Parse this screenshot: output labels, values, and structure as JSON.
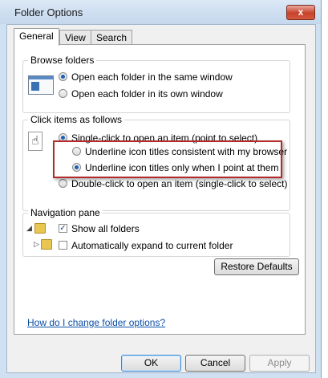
{
  "window": {
    "title": "Folder Options",
    "close_label": "x"
  },
  "tabs": [
    {
      "label": "General",
      "active": true
    },
    {
      "label": "View",
      "active": false
    },
    {
      "label": "Search",
      "active": false
    }
  ],
  "browse_folders": {
    "legend": "Browse folders",
    "options": [
      {
        "label": "Open each folder in the same window",
        "selected": true
      },
      {
        "label": "Open each folder in its own window",
        "selected": false
      }
    ]
  },
  "click_items": {
    "legend": "Click items as follows",
    "single_click": {
      "label": "Single-click to open an item (point to select)",
      "selected": true
    },
    "underline_consistent": {
      "label": "Underline icon titles consistent with my browser",
      "selected": false
    },
    "underline_point": {
      "label": "Underline icon titles only when I point at them",
      "selected": true
    },
    "double_click": {
      "label": "Double-click to open an item (single-click to select)",
      "selected": false
    }
  },
  "navigation_pane": {
    "legend": "Navigation pane",
    "show_all_folders": {
      "label": "Show all folders",
      "checked": true
    },
    "auto_expand": {
      "label": "Automatically expand to current folder",
      "checked": false
    }
  },
  "buttons": {
    "restore_defaults": "Restore Defaults",
    "ok": "OK",
    "cancel": "Cancel",
    "apply": "Apply"
  },
  "help_link": "How do I change folder options?",
  "icons": {
    "browse": "folder-window-icon",
    "click": "hand-pointer-icon",
    "nav_expanded": "triangle-expanded-icon",
    "nav_collapsed": "triangle-collapsed-icon",
    "folder": "folder-icon"
  },
  "colors": {
    "highlight_border": "#b22a2a",
    "link": "#0a4ea6",
    "title_bar": "#cfe0f2"
  }
}
